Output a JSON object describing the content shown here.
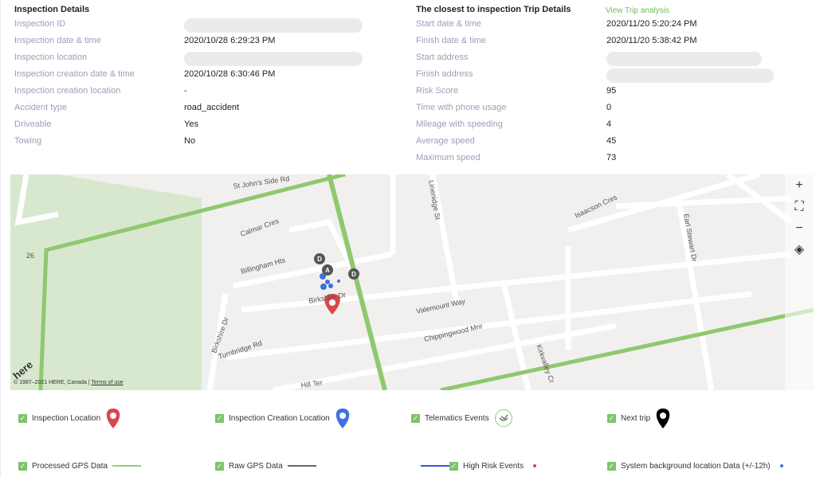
{
  "inspection": {
    "title": "Inspection Details",
    "rows": [
      {
        "label": "Inspection ID",
        "value": "",
        "redacted": true
      },
      {
        "label": "Inspection date & time",
        "value": "2020/10/28 6:29:23 PM"
      },
      {
        "label": "Inspection location",
        "value": "",
        "redacted": true
      },
      {
        "label": "Inspection creation date & time",
        "value": "2020/10/28 6:30:46 PM"
      },
      {
        "label": "Inspection creation location",
        "value": "-"
      },
      {
        "label": "Accident type",
        "value": "road_accident"
      },
      {
        "label": "Driveable",
        "value": "Yes"
      },
      {
        "label": "Towing",
        "value": "No"
      }
    ]
  },
  "trip": {
    "title": "The closest to inspection Trip Details",
    "link": "View Trip analysis",
    "rows": [
      {
        "label": "Start date & time",
        "value": "2020/11/20 5:20:24 PM"
      },
      {
        "label": "Finish date & time",
        "value": "2020/11/20 5:38:42 PM"
      },
      {
        "label": "Start address",
        "value": "",
        "redacted": true
      },
      {
        "label": "Finish address",
        "value": "",
        "redacted": true
      },
      {
        "label": "Risk Score",
        "value": "95"
      },
      {
        "label": "Time with phone usage",
        "value": "0"
      },
      {
        "label": "Mileage with speeding",
        "value": "4"
      },
      {
        "label": "Average speed",
        "value": "45"
      },
      {
        "label": "Maximum speed",
        "value": "73"
      }
    ]
  },
  "map": {
    "streets": [
      "St John's Side Rd",
      "Calmar Cres",
      "Billingham Hts",
      "Birkshire Dr",
      "Birkshire Dr",
      "Turnbridge Rd",
      "Valemount Way",
      "Chippingwood Mnr",
      "Linenidge St",
      "Kirkvalley Cr",
      "Isaacson Cres",
      "Earl Stewart Dr",
      "Hill Ter",
      "26"
    ],
    "markers": [
      "D",
      "A",
      "D"
    ],
    "logo": "here",
    "copyright": "© 1987–2021 HERE, Canada |",
    "terms": "Terms of use",
    "controls": [
      "+",
      "⛶",
      "−",
      "◈"
    ]
  },
  "legend": [
    {
      "label": "Inspection Location",
      "checked": true,
      "icon": "red-pin-icon",
      "color": "#d9464b"
    },
    {
      "label": "Inspection Creation Location",
      "checked": true,
      "icon": "blue-pin-icon",
      "color": "#3f6fe0"
    },
    {
      "label": "Telematics Events",
      "checked": true,
      "icon": "telematics-event-icon"
    },
    {
      "label": "Next trip",
      "checked": true,
      "icon": "next-trip-pins-icon"
    },
    {
      "label": "Processed GPS Data",
      "checked": true,
      "icon": "green-line-icon",
      "color": "#8fd16e"
    },
    {
      "label": "Raw GPS Data",
      "checked": true,
      "icon": "gray-line-icon",
      "color": "#666666"
    },
    {
      "label": "High Risk Events",
      "checked": true,
      "icon": "red-dot-icon",
      "color": "#d9464b"
    },
    {
      "label": "System background location Data (+/-12h)",
      "checked": true,
      "icon": "blue-dot-icon",
      "color": "#3f6fe0"
    }
  ]
}
